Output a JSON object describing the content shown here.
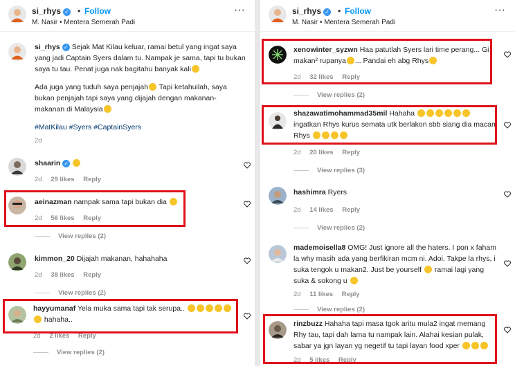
{
  "left": {
    "header": {
      "username": "si_rhys",
      "dot": "•",
      "follow": "Follow",
      "subtitle": "M. Nasir • Mentera Semerah Padi"
    },
    "caption": {
      "username": "si_rhys",
      "line1": "Sejak Mat Kilau keluar, ramai betul yang ingat saya",
      "line2": "yang jadi Captain Syers dalam tu. Nampak je sama, tapi tu bukan",
      "line3": "saya tu tau. Penat juga nak bagitahu banyak kali",
      "line4": "Ada juga yang tuduh saya penjajah",
      "line4b": "Tapi ketahuilah, saya",
      "line5": "bukan penjajah tapi saya yang dijajah dengan makanan-",
      "line6": "makanan di Malaysia",
      "hashtags": "#MatKilau #Syers #CaptainSyers",
      "time": "2d"
    },
    "comments": [
      {
        "username": "shaarin",
        "text": "",
        "time": "2d",
        "likes": "29 likes",
        "reply": "Reply"
      },
      {
        "username": "aeinazman",
        "text": "nampak sama tapi bukan dia",
        "time": "2d",
        "likes": "56 likes",
        "reply": "Reply",
        "view": "View replies (2)"
      },
      {
        "username": "kimmon_20",
        "text": "Dijajah makanan, hahahaha",
        "time": "2d",
        "likes": "38 likes",
        "reply": "Reply",
        "view": "View replies (2)"
      },
      {
        "username": "hayyumanaf",
        "text": "Yela muka sama tapi tak serupa..",
        "text2": "hahaha..",
        "time": "2d",
        "likes": "2 likes",
        "reply": "Reply",
        "view": "View replies (2)"
      }
    ]
  },
  "right": {
    "header": {
      "username": "si_rhys",
      "dot": "•",
      "follow": "Follow",
      "subtitle": "M. Nasir • Mentera Semerah Padi"
    },
    "comments": [
      {
        "username": "xenowinter_syzwn",
        "text": "Haa patutlah Syers lari time perang... Gi",
        "text2": "makan² rupanya",
        "text2b": "... Pandai eh abg Rhys",
        "time": "2d",
        "likes": "32 likes",
        "reply": "Reply",
        "view": "View replies (2)"
      },
      {
        "username": "shazawatimohammad35mil",
        "text": "Hahaha",
        "text2": "ingatkan Rhys kurus semata utk berlakon sbb siang dia macam",
        "text3": "Rhys",
        "time": "2d",
        "likes": "20 likes",
        "reply": "Reply",
        "view": "View replies (3)"
      },
      {
        "username": "hashimra",
        "text": "Ryers",
        "time": "2d",
        "likes": "14 likes",
        "reply": "Reply",
        "view": "View replies (2)"
      },
      {
        "username": "mademoisella8",
        "text": "OMG! Just ignore all the haters. I pon x faham",
        "text2": "la why masih ada yang berfikiran mcm ni. Adoi. Takpe la rhys, i",
        "text3": "suka tengok u makan2. Just be yourself",
        "text3b": "ramai lagi yang",
        "text4": "suka & sokong u",
        "time": "2d",
        "likes": "11 likes",
        "reply": "Reply",
        "view": "View replies (2)"
      },
      {
        "username": "rinzbuzz",
        "text": "Hahaha tapi masa tgok aritu mula2 ingat memang",
        "text2": "Rhy tau, tapi dah lama tu nampak lain. Alahai kesian pulak,",
        "text3": "sabar ya jgn layan yg negetif tu tapi layan food xper",
        "time": "2d",
        "likes": "5 likes",
        "reply": "Reply"
      }
    ]
  },
  "colors": {
    "follow": "#0095f6",
    "highlight": "#e0101a",
    "muted": "#8e8e8e"
  }
}
